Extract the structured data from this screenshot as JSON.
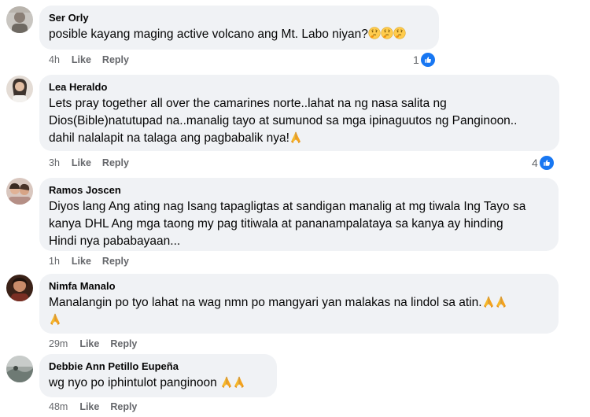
{
  "comments": [
    {
      "author": "Ser Orly",
      "text": "posible kayang maging active volcano ang Mt. Labo niyan?",
      "emoji": [
        "thinking-face-emoji",
        "thinking-face-emoji",
        "thinking-face-emoji"
      ],
      "time": "4h",
      "like_label": "Like",
      "reply_label": "Reply",
      "reaction_count": "1",
      "reaction_type": "like"
    },
    {
      "author": "Lea Heraldo",
      "text_lines": [
        "Lets pray together all over the camarines norte..lahat na ng nasa salita ng",
        "Dios(Bible)natutupad na..manalig tayo at sumunod sa mga ipinaguutos ng Panginoon..",
        "dahil nalalapit na talaga ang pagbabalik nya!"
      ],
      "emoji": [
        "folded-hands-emoji"
      ],
      "time": "3h",
      "like_label": "Like",
      "reply_label": "Reply",
      "reaction_count": "4",
      "reaction_type": "like"
    },
    {
      "author": "Ramos Joscen",
      "text_lines": [
        "Diyos lang Ang ating nag Isang tapagligtas at sandigan manalig at mg tiwala Ing Tayo sa",
        "kanya DHL Ang mga taong my pag titiwala at pananampalataya sa kanya ay hinding",
        "Hindi nya pababayaan..."
      ],
      "time": "1h",
      "like_label": "Like",
      "reply_label": "Reply"
    },
    {
      "author": "Nimfa Manalo",
      "text": "Manalangin po tyo lahat na wag nmn po mangyari yan malakas na lindol sa atin.",
      "emoji": [
        "folded-hands-emoji",
        "folded-hands-emoji",
        "folded-hands-emoji"
      ],
      "time": "29m",
      "like_label": "Like",
      "reply_label": "Reply"
    },
    {
      "author": "Debbie Ann Petillo Eupeña",
      "text": "wg nyo po iphintulot panginoon",
      "emoji": [
        "folded-hands-emoji",
        "folded-hands-emoji"
      ],
      "time": "48m",
      "like_label": "Like",
      "reply_label": "Reply"
    }
  ],
  "colors": {
    "bubble": "#f0f2f5",
    "meta_text": "#65676b",
    "like_blue": "#1877f2"
  }
}
